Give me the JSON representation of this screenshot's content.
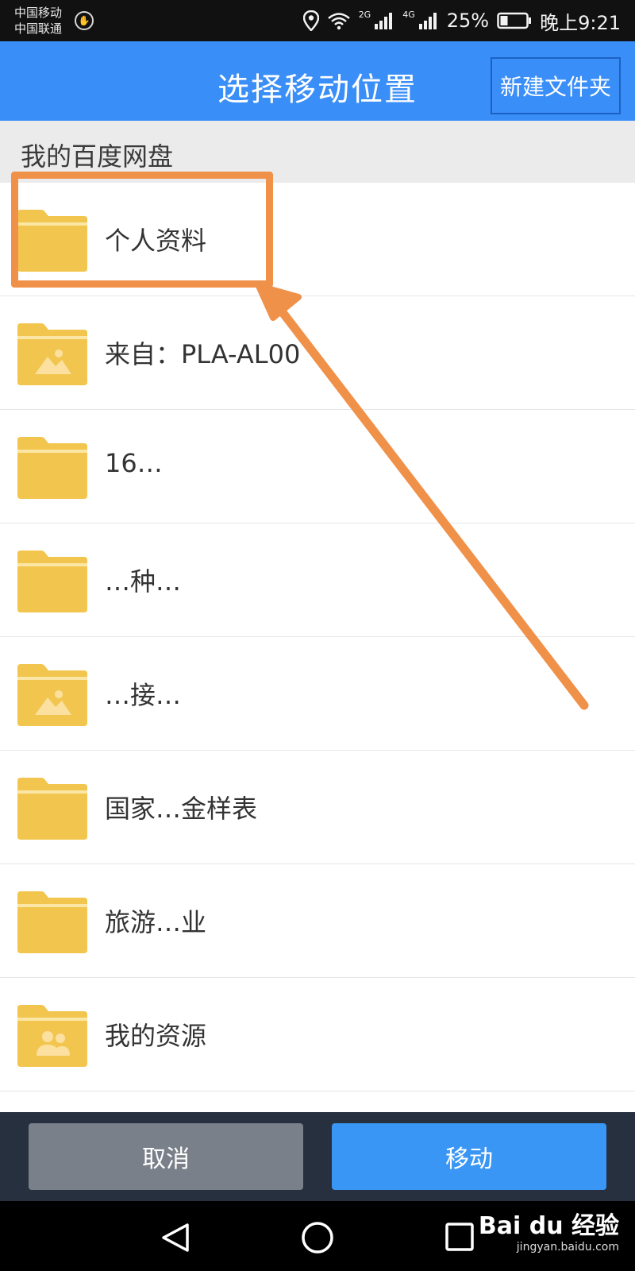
{
  "status_bar": {
    "carrier_1": "中国移动",
    "carrier_2": "中国联通",
    "net_1": "2G",
    "net_2": "4G",
    "battery": "25%",
    "time": "晚上9:21"
  },
  "app_bar": {
    "title": "选择移动位置",
    "new_folder_label": "新建文件夹"
  },
  "path": {
    "current": "我的百度网盘"
  },
  "folders": [
    {
      "name": "个人资料",
      "icon": "folder-icon"
    },
    {
      "name": "来自：PLA-AL00",
      "icon": "folder-image-icon"
    },
    {
      "name": "16…",
      "icon": "folder-icon"
    },
    {
      "name": "…种…",
      "icon": "folder-icon"
    },
    {
      "name": "…接…",
      "icon": "folder-image-icon"
    },
    {
      "name": "国家…金样表",
      "icon": "folder-icon"
    },
    {
      "name": "旅游…业",
      "icon": "folder-icon"
    },
    {
      "name": "我的资源",
      "icon": "folder-shared-icon"
    }
  ],
  "actions": {
    "cancel_label": "取消",
    "move_label": "移动"
  },
  "watermark": {
    "brand": "Bai du 经验",
    "site": "jingyan.baidu.com"
  },
  "colors": {
    "app_bar": "#3a8ef8",
    "folder": "#f2c64e",
    "highlight": "#f0914a",
    "move_button": "#3a96f5",
    "cancel_button": "#7a8089"
  }
}
